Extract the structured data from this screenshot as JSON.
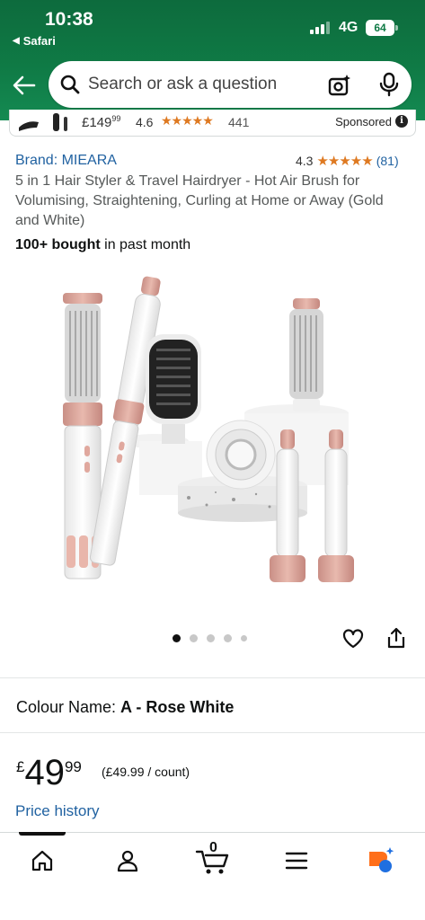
{
  "status_bar": {
    "time": "10:38",
    "back_app": "Safari",
    "network": "4G",
    "battery": "64"
  },
  "search": {
    "placeholder": "Search or ask a question"
  },
  "sponsored_strip": {
    "price_whole": "£149",
    "price_fraction": "99",
    "rating": "4.6",
    "stars": "★★★★★",
    "review_count": "441",
    "sponsored_label": "Sponsored"
  },
  "product": {
    "brand": "Brand: MIEARA",
    "rating": "4.3",
    "stars": "★★★★★",
    "rating_count": "(81)",
    "title": "5 in 1 Hair Styler & Travel Hairdryer - Hot Air Brush for Volumising, Straightening, Curling at Home or Away (Gold and White)",
    "bought_bold": "100+ bought",
    "bought_rest": " in past month",
    "image_count": 5,
    "active_image_index": 0
  },
  "colour": {
    "label": "Colour Name: ",
    "value": "A - Rose White"
  },
  "price": {
    "currency": "£",
    "whole": "49",
    "fraction": "99",
    "unit_price": "(£49.99 / count)",
    "history_link": "Price history"
  },
  "bottom_nav": {
    "cart_count": "0",
    "items": [
      "home",
      "account",
      "cart",
      "menu",
      "rufus"
    ]
  },
  "colors": {
    "header_green": "#0f7a45",
    "link_blue": "#2162a1",
    "star_orange": "#de7921"
  }
}
